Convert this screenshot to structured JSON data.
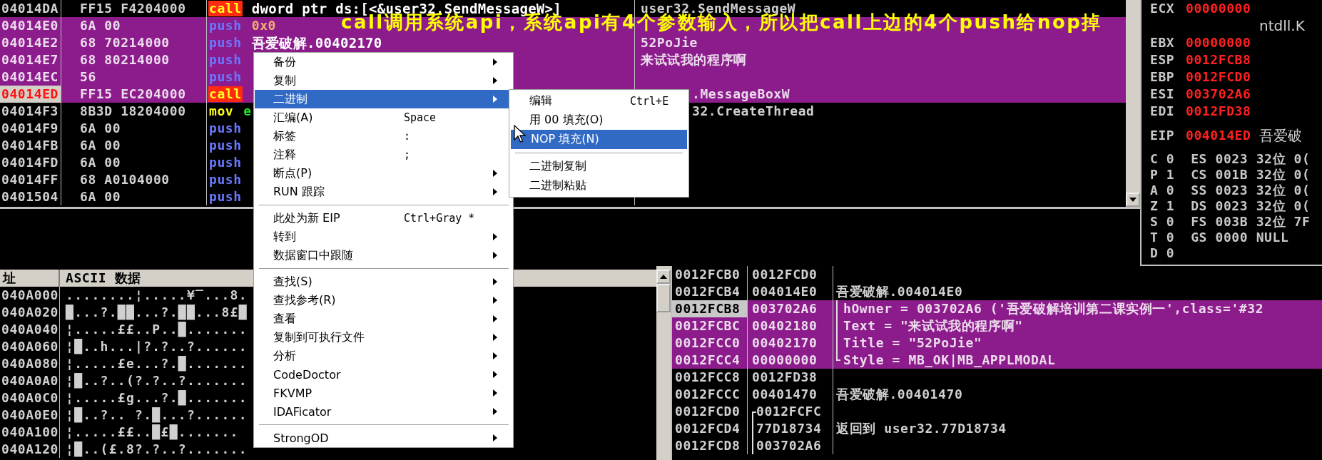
{
  "caption": "call调用系统api，系统api有4个参数输入，所以把call上边的4个push给nop掉",
  "disassembly": {
    "rows": [
      {
        "address": "04014DA",
        "hex": "FF15 F4204000",
        "kind": "call",
        "mnemonic": "call",
        "operand": {
          "text": "dword ptr ds:[<&user32.SendMessageW>]",
          "kind": "symbol"
        },
        "comment": "user32.SendMessageW",
        "selected": false,
        "eip": false
      },
      {
        "address": "04014E0",
        "hex": "6A 00",
        "kind": "push",
        "mnemonic": "push",
        "operand": {
          "text": "0x0",
          "kind": "const"
        },
        "selected": true,
        "eip": false
      },
      {
        "address": "04014E2",
        "hex": "68 70214000",
        "kind": "push",
        "mnemonic": "push",
        "operand": {
          "text": "吾爱破解.00402170",
          "kind": "symbol"
        },
        "comment": "52PoJie",
        "selected": true,
        "eip": false
      },
      {
        "address": "04014E7",
        "hex": "68 80214000",
        "kind": "push",
        "mnemonic": "push",
        "comment": "来试试我的程序啊",
        "selected": true,
        "eip": false
      },
      {
        "address": "04014EC",
        "hex": "56",
        "kind": "push",
        "mnemonic": "push",
        "selected": true,
        "eip": false
      },
      {
        "address": "04014ED",
        "hex": "FF15 EC204000",
        "kind": "call",
        "mnemonic": "call",
        "comment": ".MessageBoxW",
        "selected": true,
        "eip": true,
        "behind_submenu": true
      },
      {
        "address": "04014F3",
        "hex": "8B3D 18204000",
        "kind": "mov",
        "mnemonic": "mov",
        "operand": {
          "text": "e",
          "kind": "reg"
        },
        "comment": "32.CreateThread",
        "selected": false,
        "eip": false,
        "behind_submenu": true
      },
      {
        "address": "04014F9",
        "hex": "6A 00",
        "kind": "push",
        "mnemonic": "push",
        "selected": false,
        "eip": false
      },
      {
        "address": "04014FB",
        "hex": "6A 00",
        "kind": "push",
        "mnemonic": "push",
        "selected": false,
        "eip": false
      },
      {
        "address": "04014FD",
        "hex": "6A 00",
        "kind": "push",
        "mnemonic": "push",
        "selected": false,
        "eip": false
      },
      {
        "address": "04014FF",
        "hex": "68 A0104000",
        "kind": "push",
        "mnemonic": "push",
        "selected": false,
        "eip": false
      },
      {
        "address": "0401504",
        "hex": "6A 00",
        "kind": "push",
        "mnemonic": "push",
        "selected": false,
        "eip": false
      }
    ]
  },
  "registers": {
    "general": [
      {
        "name": "ECX",
        "value": "00000000",
        "changed": true
      },
      {
        "comment": "ntdll.K"
      },
      {
        "name": "EBX",
        "value": "00000000",
        "changed": true
      },
      {
        "name": "ESP",
        "value": "0012FCB8",
        "changed": true
      },
      {
        "name": "EBP",
        "value": "0012FCD0",
        "changed": true
      },
      {
        "name": "ESI",
        "value": "003702A6",
        "changed": true
      },
      {
        "name": "EDI",
        "value": "0012FD38",
        "changed": true
      }
    ],
    "eip": {
      "name": "EIP",
      "value": "004014ED",
      "comment": "吾爱破",
      "changed": true
    },
    "flags": [
      "C 0  ES 0023 32位 0(",
      "P 1  CS 001B 32位 0(",
      "A 0  SS 0023 32位 0(",
      "Z 1  DS 0023 32位 0(",
      "S 0  FS 003B 32位 7F",
      "T 0  GS 0000 NULL",
      "D 0"
    ]
  },
  "dump": {
    "columns": [
      "址",
      "ASCII 数据"
    ],
    "rows": [
      {
        "address": "040A000",
        "ascii": "........¦.....¥‾...8."
      },
      {
        "address": "040A020",
        "ascii": "█...?.██...?.██...8£█"
      },
      {
        "address": "040A040",
        "ascii": "¦.....££..P..█......."
      },
      {
        "address": "040A060",
        "ascii": "¦█..h...|?.?..?......"
      },
      {
        "address": "040A080",
        "ascii": "¦.....£e...?.█......."
      },
      {
        "address": "040A0A0",
        "ascii": "¦█..?..(?.?..?......."
      },
      {
        "address": "040A0C0",
        "ascii": "¦.....£g...?.█......."
      },
      {
        "address": "040A0E0",
        "ascii": "¦█..?.. ?.█...?......"
      },
      {
        "address": "040A100",
        "ascii": "¦.....££..█£█......."
      },
      {
        "address": "040A120",
        "ascii": "¦█..(£.8?.?..?......."
      }
    ]
  },
  "stack": {
    "rows": [
      {
        "kind": "plain",
        "address": "0012FCB0",
        "value": "0012FCD0",
        "selected": false,
        "esp": false
      },
      {
        "kind": "plain",
        "address": "0012FCB4",
        "value": "004014E0",
        "comment": "吾爱破解.004014E0",
        "selected": false,
        "esp": false
      },
      {
        "kind": "arg",
        "address": "0012FCB8",
        "value": "003702A6",
        "comment": "hOwner = 003702A6 ('吾爱破解培训第二课实例一',class='#32",
        "selected": true,
        "esp": true
      },
      {
        "kind": "arg",
        "address": "0012FCBC",
        "value": "00402180",
        "comment": "Text = \"来试试我的程序啊\"",
        "selected": true,
        "esp": false
      },
      {
        "kind": "arg",
        "address": "0012FCC0",
        "value": "00402170",
        "comment": "Title = \"52PoJie\"",
        "selected": true,
        "esp": false
      },
      {
        "kind": "lastarg",
        "address": "0012FCC4",
        "value": "00000000",
        "comment": "Style = MB_OK|MB_APPLMODAL",
        "selected": true,
        "esp": false
      },
      {
        "kind": "plain",
        "address": "0012FCC8",
        "value": "0012FD38",
        "selected": false,
        "esp": false
      },
      {
        "kind": "plain",
        "address": "0012FCCC",
        "value": "00401470",
        "comment": "吾爱破解.00401470",
        "selected": false,
        "esp": false
      },
      {
        "kind": "framestart",
        "address": "0012FCD0",
        "value": "0012FCFC",
        "selected": false,
        "esp": false
      },
      {
        "kind": "frame",
        "address": "0012FCD4",
        "value": "77D18734",
        "comment": "返回到 user32.77D18734",
        "selected": false,
        "esp": false
      },
      {
        "kind": "frame",
        "address": "0012FCD8",
        "value": "003702A6",
        "selected": false,
        "esp": false
      }
    ]
  },
  "context_menu": {
    "items": [
      {
        "kind": "item",
        "label": "备份",
        "submenu": true,
        "selected": false
      },
      {
        "kind": "item",
        "label": "复制",
        "submenu": true,
        "selected": false
      },
      {
        "kind": "item",
        "label": "二进制",
        "submenu": true,
        "selected": true
      },
      {
        "kind": "item",
        "label": "汇编(A)",
        "shortcut": "Space",
        "submenu": false,
        "selected": false
      },
      {
        "kind": "item",
        "label": "标签",
        "shortcut": ":",
        "submenu": false,
        "selected": false
      },
      {
        "kind": "item",
        "label": "注释",
        "shortcut": ";",
        "submenu": false,
        "selected": false
      },
      {
        "kind": "item",
        "label": "断点(P)",
        "submenu": true,
        "selected": false
      },
      {
        "kind": "item",
        "label": "RUN 跟踪",
        "submenu": true,
        "selected": false
      },
      {
        "kind": "separator"
      },
      {
        "kind": "item",
        "label": "此处为新 EIP",
        "shortcut": "Ctrl+Gray *",
        "submenu": false,
        "selected": false
      },
      {
        "kind": "item",
        "label": "转到",
        "submenu": true,
        "selected": false
      },
      {
        "kind": "item",
        "label": "数据窗口中跟随",
        "submenu": true,
        "selected": false
      },
      {
        "kind": "separator"
      },
      {
        "kind": "item",
        "label": "查找(S)",
        "submenu": true,
        "selected": false
      },
      {
        "kind": "item",
        "label": "查找参考(R)",
        "submenu": true,
        "selected": false
      },
      {
        "kind": "item",
        "label": "查看",
        "submenu": true,
        "selected": false
      },
      {
        "kind": "item",
        "label": "复制到可执行文件",
        "submenu": true,
        "selected": false
      },
      {
        "kind": "item",
        "label": "分析",
        "submenu": true,
        "selected": false
      },
      {
        "kind": "item",
        "label": "CodeDoctor",
        "submenu": true,
        "selected": false
      },
      {
        "kind": "item",
        "label": "FKVMP",
        "submenu": true,
        "selected": false
      },
      {
        "kind": "item",
        "label": "IDAFicator",
        "submenu": true,
        "selected": false
      },
      {
        "kind": "separator"
      },
      {
        "kind": "item",
        "label": "StrongOD",
        "submenu": true,
        "selected": false
      }
    ]
  },
  "submenu": {
    "items": [
      {
        "kind": "item",
        "label": "编辑",
        "shortcut": "Ctrl+E",
        "selected": false,
        "pointer": false
      },
      {
        "kind": "item",
        "label": "用 00 填充(O)",
        "selected": false,
        "pointer": false
      },
      {
        "kind": "item",
        "label": "NOP 填充(N)",
        "selected": true,
        "pointer": true
      },
      {
        "kind": "separator"
      },
      {
        "kind": "item",
        "label": "二进制复制",
        "selected": false,
        "pointer": false
      },
      {
        "kind": "item",
        "label": "二进制粘贴",
        "selected": false,
        "pointer": false
      }
    ]
  }
}
